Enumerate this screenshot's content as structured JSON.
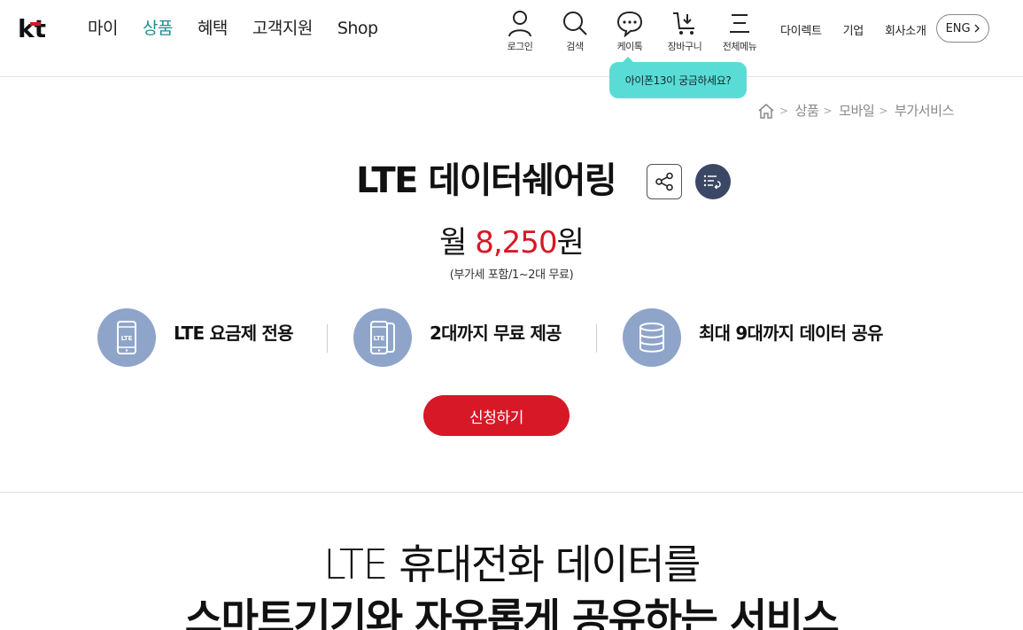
{
  "header": {
    "logo": "kt",
    "nav": [
      {
        "label": "마이"
      },
      {
        "label": "상품"
      },
      {
        "label": "혜택"
      },
      {
        "label": "고객지원"
      },
      {
        "label": "Shop"
      }
    ],
    "active_nav": "상품",
    "accent_color": "#1a8f8a",
    "util": [
      {
        "label": "로그인",
        "icon": "person-icon"
      },
      {
        "label": "검색",
        "icon": "search-icon"
      },
      {
        "label": "케이톡",
        "icon": "chat-icon"
      },
      {
        "label": "장바구니",
        "icon": "cart-icon"
      },
      {
        "label": "전체메뉴",
        "icon": "menu-icon"
      }
    ],
    "links": [
      "다이렉트",
      "기업",
      "회사소개"
    ],
    "lang": "ENG"
  },
  "tooltip": {
    "text": "아이폰13이 궁금하세요?",
    "color": "#5adcd6"
  },
  "breadcrumb": [
    "상품",
    "모바일",
    "부가서비스"
  ],
  "product": {
    "title": "LTE 데이터쉐어링",
    "price_prefix": "월 ",
    "price_value": "8,250",
    "price_suffix": "원",
    "price_note": "(부가세 포함/1~2대 무료)",
    "price_color": "#d71826"
  },
  "features": [
    {
      "label": "LTE 요금제 전용",
      "icon": "lte-phone-icon"
    },
    {
      "label": "2대까지 무료 제공",
      "icon": "lte-two-phones-icon"
    },
    {
      "label": "최대 9대까지 데이터 공유",
      "icon": "database-icon"
    }
  ],
  "apply_button": "신청하기",
  "intro": {
    "line1": "LTE 휴대전화 데이터를",
    "line2": "스마트기기와 자유롭게 공유하는 서비스"
  }
}
